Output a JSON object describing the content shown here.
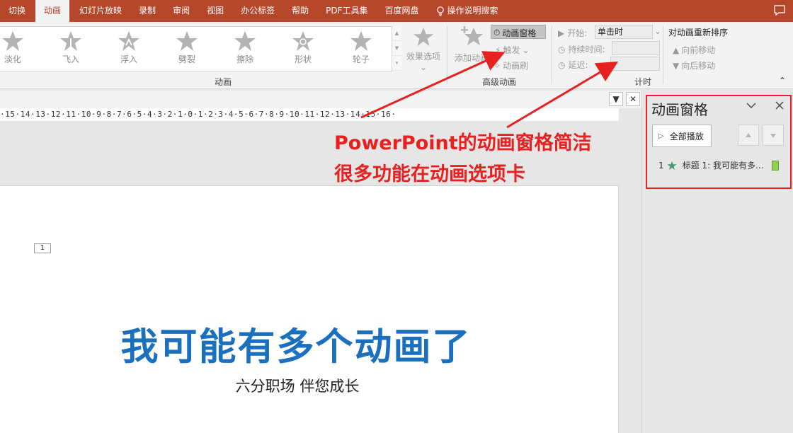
{
  "tabs": [
    "切换",
    "动画",
    "幻灯片放映",
    "录制",
    "审阅",
    "视图",
    "办公标签",
    "帮助",
    "PDF工具集",
    "百度网盘"
  ],
  "tell_me": "操作说明搜索",
  "animation_gallery": [
    "淡化",
    "飞入",
    "浮入",
    "劈裂",
    "擦除",
    "形状",
    "轮子"
  ],
  "effect_options": "效果选项",
  "groups": {
    "animation": "动画",
    "advanced": "高级动画",
    "timing": "计时"
  },
  "advanced": {
    "add_animation": "添加动画",
    "animation_pane": "动画窗格",
    "trigger": "触发",
    "animation_painter": "动画刷"
  },
  "timing": {
    "start_label": "开始:",
    "start_value": "单击时",
    "duration_label": "持续时间:",
    "delay_label": "延迟:",
    "reorder_title": "对动画重新排序",
    "move_earlier": "向前移动",
    "move_later": "向后移动"
  },
  "ruler": "·15·14·13·12·11·10·9·8·7·6·5·4·3·2·1·0·1·2·3·4·5·6·7·8·9·10·11·12·13·14·15·16·",
  "annotation": {
    "line1": "PowerPoint的动画窗格简洁",
    "line2": "很多功能在动画选项卡"
  },
  "slide": {
    "number": "1",
    "title": "我可能有多个动画了",
    "subtitle": "六分职场 伴您成长"
  },
  "pane": {
    "title": "动画窗格",
    "play_all": "全部播放",
    "item_index": "1",
    "item_label": "标题 1: 我可能有多..."
  },
  "colors": {
    "tab_bar": "#b7472a",
    "annotation": "#e82020",
    "slide_title": "#1a6fbf",
    "timeline_bar": "#92d050"
  }
}
